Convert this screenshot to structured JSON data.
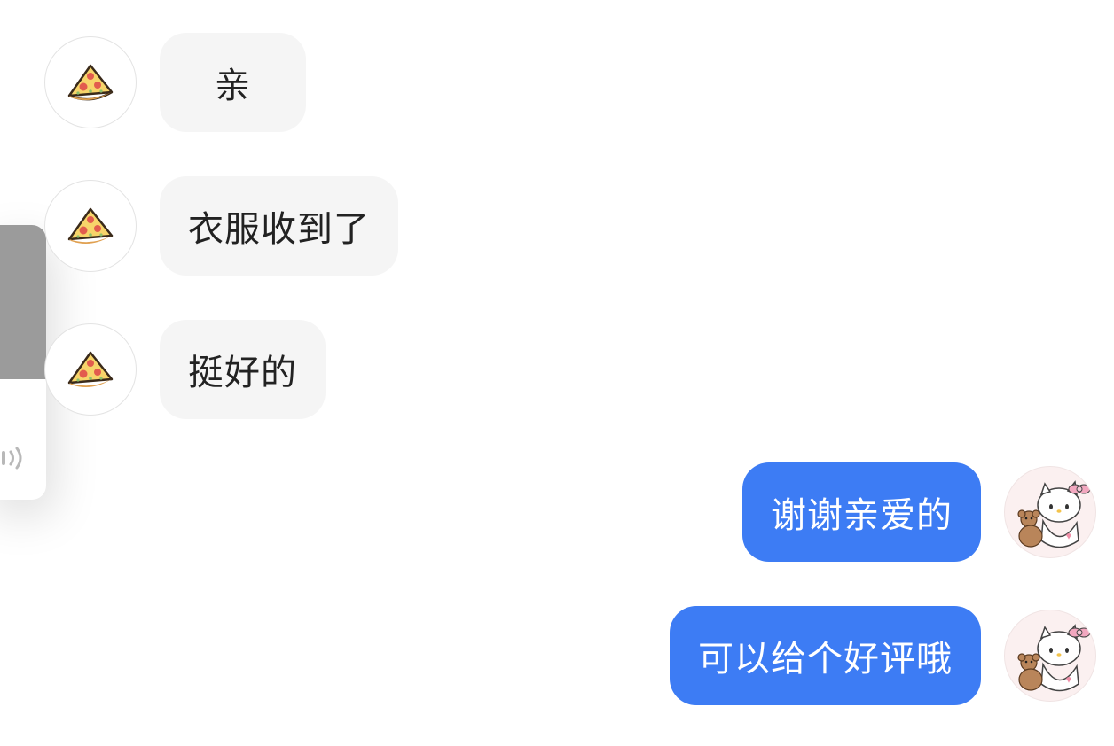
{
  "messages": [
    {
      "side": "left",
      "text": "亲",
      "avatar": "pizza-icon"
    },
    {
      "side": "left",
      "text": "衣服收到了",
      "avatar": "pizza-icon"
    },
    {
      "side": "left",
      "text": "挺好的",
      "avatar": "pizza-icon"
    },
    {
      "side": "right",
      "text": "谢谢亲爱的",
      "avatar": "hello-kitty-avatar"
    },
    {
      "side": "right",
      "text": "可以给个好评哦",
      "avatar": "hello-kitty-avatar"
    }
  ],
  "side_panel": {
    "icon": "sound-icon"
  },
  "colors": {
    "incoming_bubble": "#f5f5f5",
    "outgoing_bubble": "#3d7cf4",
    "incoming_text": "#222222",
    "outgoing_text": "#ffffff"
  }
}
